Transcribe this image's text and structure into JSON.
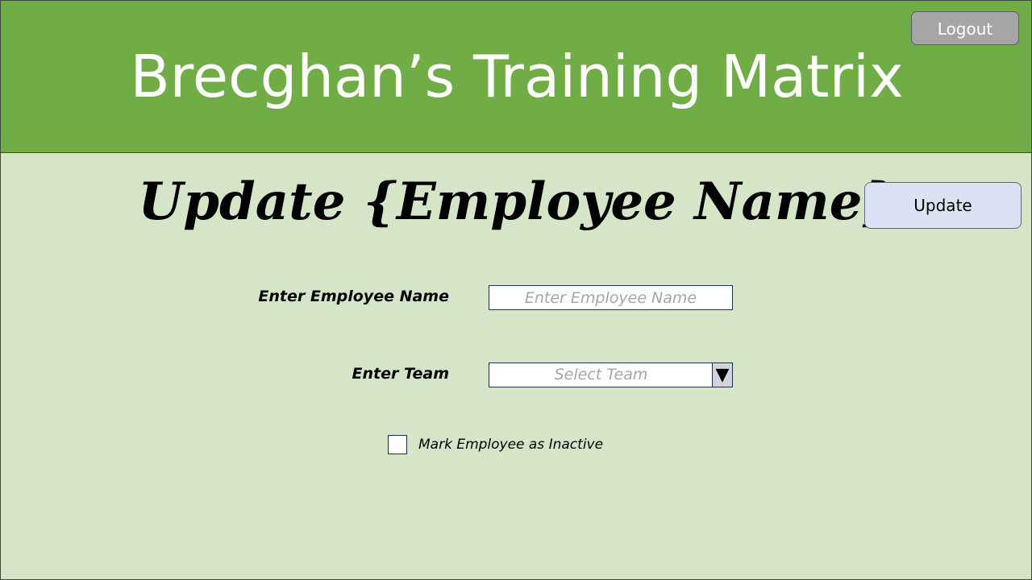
{
  "header": {
    "app_title": "Brecghan’s Training Matrix",
    "logout_label": "Logout"
  },
  "page": {
    "title": "Update {Employee Name}",
    "update_label": "Update"
  },
  "form": {
    "employee_name": {
      "label": "Enter Employee Name",
      "value": "",
      "placeholder": "Enter Employee Name"
    },
    "team": {
      "label": "Enter Team",
      "selected": "Select Team",
      "arrow_icon": "triangle-down-icon"
    },
    "inactive": {
      "label": "Mark Employee as Inactive",
      "checked": false
    }
  },
  "colors": {
    "header_bg": "#70ad47",
    "page_bg": "#d5e5c8",
    "logout_bg": "#a5a5a5",
    "update_bg": "#dae3f3"
  }
}
